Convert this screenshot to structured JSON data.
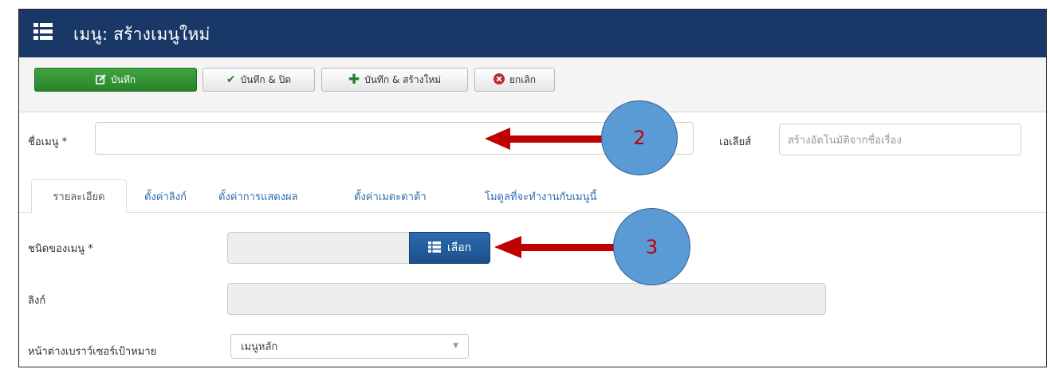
{
  "header": {
    "title": "เมนู: สร้างเมนูใหม่",
    "icon": "list-icon"
  },
  "toolbar": {
    "save_label": "บันทึก",
    "save_close_label": "บันทึก & ปิด",
    "save_new_label": "บันทึก & สร้างใหม่",
    "cancel_label": "ยกเลิก"
  },
  "form": {
    "menu_title_label": "ชื่อเมนู *",
    "menu_title_value": "",
    "alias_label": "เอเลียส์",
    "alias_placeholder": "สร้างอัตโนมัติจากชื่อเรื่อง"
  },
  "tabs": [
    {
      "label": "รายละเอียด",
      "active": true
    },
    {
      "label": "ตั้งค่าลิงก์"
    },
    {
      "label": "ตั้งค่าการแสดงผล"
    },
    {
      "label": "ตั้งค่าเมตะดาต้า"
    },
    {
      "label": "โมดูลที่จะทำงานกับเมนูนี้"
    }
  ],
  "details": {
    "menu_type_label": "ชนิดของเมนู *",
    "select_button_label": "เลือก",
    "link_label": "ลิงก์",
    "target_window_label": "หน้าต่างเบราว์เซอร์เป้าหมาย",
    "target_window_value": "เมนูหลัก"
  },
  "annotations": {
    "callout_2": "2",
    "callout_3": "3"
  },
  "colors": {
    "header_bg": "#1a3867",
    "save_green": "#2f8f2f",
    "select_blue": "#245e9f",
    "callout_fill": "#5b9bd5",
    "arrow_red": "#c00000"
  }
}
